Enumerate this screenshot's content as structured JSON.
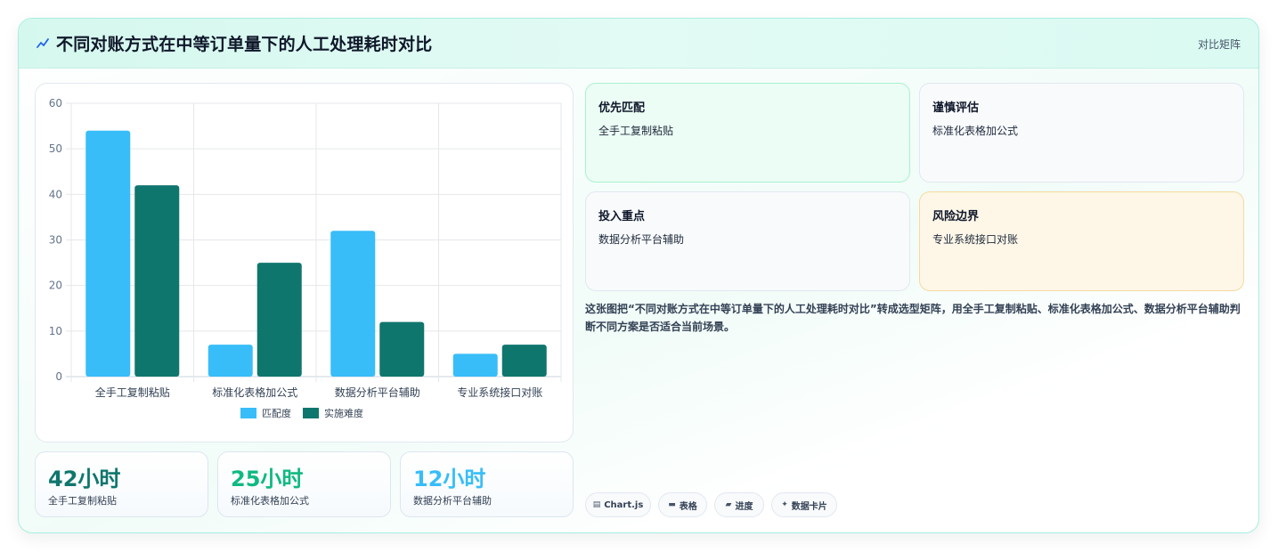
{
  "header": {
    "title": "不同对账方式在中等订单量下的人工处理耗时对比",
    "right_label": "对比矩阵",
    "icon": "chart-spark-icon"
  },
  "chart_data": {
    "type": "bar",
    "categories": [
      "全手工复制粘贴",
      "标准化表格加公式",
      "数据分析平台辅助",
      "专业系统接口对账"
    ],
    "series": [
      {
        "name": "匹配度",
        "values": [
          54,
          7,
          32,
          5
        ],
        "color": "#38bdf8"
      },
      {
        "name": "实施难度",
        "values": [
          42,
          25,
          12,
          7
        ],
        "color": "#0f766e"
      }
    ],
    "ylim": [
      0,
      60
    ],
    "yticks": [
      0,
      10,
      20,
      30,
      40,
      50,
      60
    ],
    "grid": true,
    "legend": "bottom",
    "title": "",
    "xlabel": "",
    "ylabel": ""
  },
  "stats": [
    {
      "value": "42小时",
      "label": "全手工复制粘贴",
      "color": "#0f766e"
    },
    {
      "value": "25小时",
      "label": "标准化表格加公式",
      "color": "#10b981"
    },
    {
      "value": "12小时",
      "label": "数据分析平台辅助",
      "color": "#38bdf8"
    }
  ],
  "cards": [
    {
      "title": "优先匹配",
      "text": "全手工复制粘贴",
      "bg": "#ecfdf5",
      "border": "#a7f3d0"
    },
    {
      "title": "谨慎评估",
      "text": "标准化表格加公式",
      "bg": "#f8fafc",
      "border": "#e2e8f0"
    },
    {
      "title": "投入重点",
      "text": "数据分析平台辅助",
      "bg": "#f8fafc",
      "border": "#e2e8f0"
    },
    {
      "title": "风险边界",
      "text": "专业系统接口对账",
      "bg": "#fef7e8",
      "border": "#f6d9a0"
    }
  ],
  "description": "这张图把“不同对账方式在中等订单量下的人工处理耗时对比”转成选型矩阵，用全手工复制粘贴、标准化表格加公式、数据分析平台辅助判断不同方案是否适合当前场景。",
  "tags": [
    {
      "icon": "▤",
      "label": "Chart.js",
      "icon_name": "chart-icon"
    },
    {
      "icon": "▬",
      "label": "表格",
      "icon_name": "table-icon"
    },
    {
      "icon": "▰",
      "label": "进度",
      "icon_name": "progress-icon"
    },
    {
      "icon": "✦",
      "label": "数据卡片",
      "icon_name": "card-icon"
    }
  ]
}
